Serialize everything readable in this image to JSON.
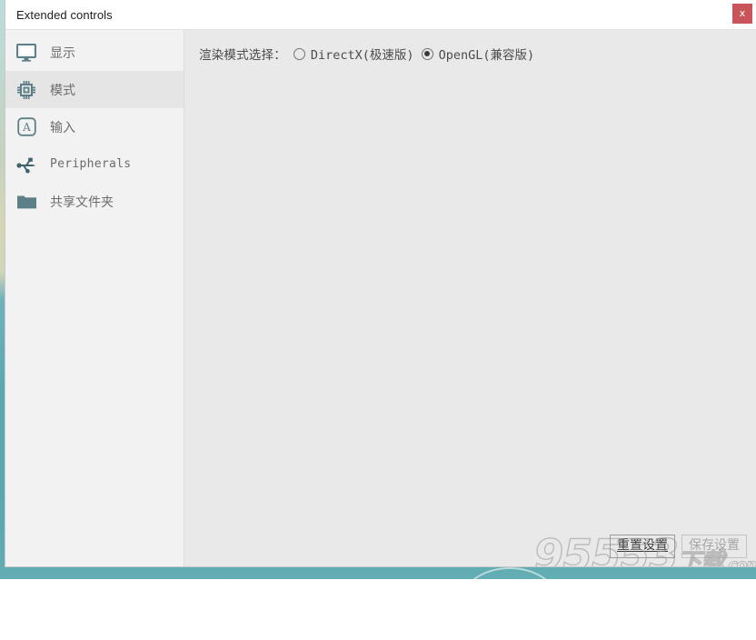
{
  "window": {
    "title": "Extended controls",
    "close_label": "x",
    "close_icon": "close-icon"
  },
  "sidebar": {
    "items": [
      {
        "label": "显示",
        "icon": "monitor-icon",
        "selected": false,
        "mono": false
      },
      {
        "label": "模式",
        "icon": "cpu-chip-icon",
        "selected": true,
        "mono": false
      },
      {
        "label": "输入",
        "icon": "input-a-icon",
        "selected": false,
        "mono": false
      },
      {
        "label": "Peripherals",
        "icon": "usb-icon",
        "selected": false,
        "mono": true
      },
      {
        "label": "共享文件夹",
        "icon": "folder-icon",
        "selected": false,
        "mono": false
      }
    ]
  },
  "content": {
    "render_mode_label": "渲染模式选择：",
    "options": [
      {
        "label": "DirectX(极速版)",
        "selected": false
      },
      {
        "label": "OpenGL(兼容版)",
        "selected": true
      }
    ]
  },
  "footer": {
    "reset_label": "重置设置",
    "save_label": "保存设置"
  },
  "watermark": {
    "number": "95553",
    "suffix": "下载",
    "domain": ".com"
  },
  "colors": {
    "close_button": "#c9555a",
    "sidebar_bg": "#f2f2f2",
    "content_bg": "#e9e9e9",
    "icon": "#5d7f88",
    "selected_row": "#e5e5e5"
  }
}
